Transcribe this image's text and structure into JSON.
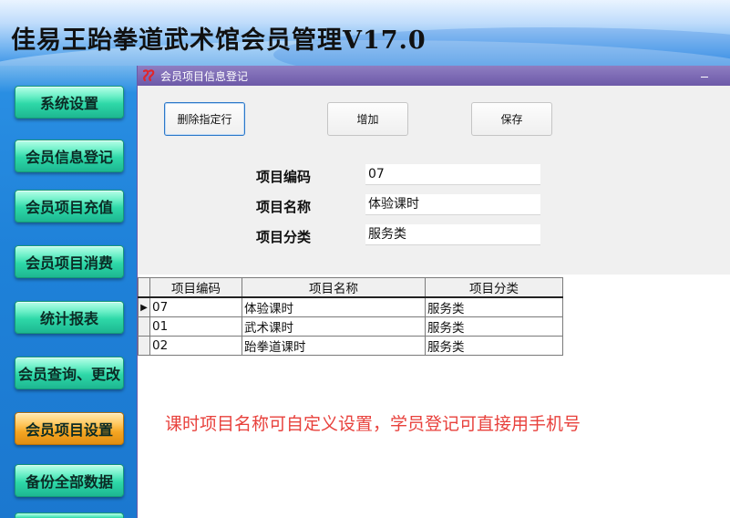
{
  "app": {
    "title": "佳易王跆拳道武术馆会员管理V17.0"
  },
  "sidebar": {
    "items": [
      {
        "label": "系统设置"
      },
      {
        "label": "会员信息登记"
      },
      {
        "label": "会员项目充值"
      },
      {
        "label": "会员项目消费"
      },
      {
        "label": "统计报表"
      },
      {
        "label": "会员查询、更改"
      },
      {
        "label": "会员项目设置"
      },
      {
        "label": "备份全部数据"
      }
    ],
    "active_item": "会员项目设置"
  },
  "window": {
    "title": "会员项目信息登记",
    "icon": "app-logo-icon",
    "minimize_icon": "minimize-icon"
  },
  "toolbar": {
    "delete_label": "删除指定行",
    "add_label": "增加",
    "save_label": "保存"
  },
  "form": {
    "code_label": "项目编码",
    "code_value": "07",
    "name_label": "项目名称",
    "name_value": "体验课时",
    "category_label": "项目分类",
    "category_value": "服务类"
  },
  "table": {
    "columns": [
      "项目编码",
      "项目名称",
      "项目分类"
    ],
    "rows": [
      {
        "code": "07",
        "name": "体验课时",
        "category": "服务类",
        "current": true
      },
      {
        "code": "01",
        "name": "武术课时",
        "category": "服务类",
        "current": false
      },
      {
        "code": "02",
        "name": "跆拳道课时",
        "category": "服务类",
        "current": false
      }
    ]
  },
  "notice": {
    "text": "课时项目名称可自定义设置，学员登记可直接用手机号",
    "color": "#e8413c"
  },
  "colors": {
    "sidebar_button": "#2ed8a8",
    "sidebar_button_active": "#f5a623",
    "window_titlebar": "#6c59a8"
  }
}
